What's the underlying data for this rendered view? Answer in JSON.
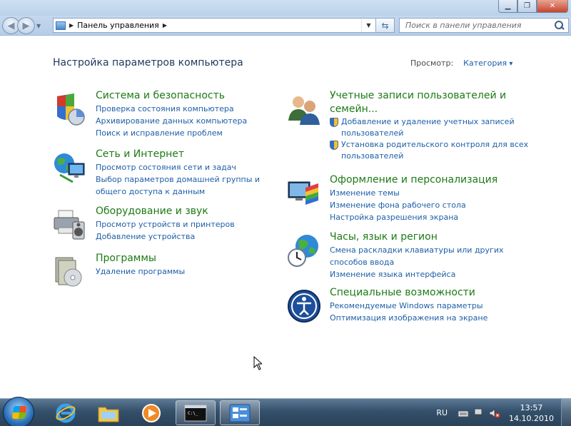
{
  "window": {
    "controls": {
      "minimize": "minimize-icon",
      "maximize": "maximize-icon",
      "close": "close-icon"
    }
  },
  "navbar": {
    "address": {
      "segments": [
        "Панель управления"
      ]
    },
    "search": {
      "placeholder": "Поиск в панели управления"
    }
  },
  "main": {
    "title": "Настройка параметров компьютера",
    "view": {
      "label": "Просмотр:",
      "value": "Категория"
    },
    "categories": [
      {
        "title": "Система и безопасность",
        "icon": "shield-icon",
        "links": [
          "Проверка состояния компьютера",
          "Архивирование данных компьютера",
          "Поиск и исправление проблем"
        ]
      },
      {
        "title": "Сеть и Интернет",
        "icon": "network-globe-icon",
        "links": [
          "Просмотр состояния сети и задач",
          "Выбор параметров домашней группы и",
          "общего доступа к данным"
        ]
      },
      {
        "title": "Оборудование и звук",
        "icon": "printer-speaker-icon",
        "links": [
          "Просмотр устройств и принтеров",
          "Добавление устройства"
        ]
      },
      {
        "title": "Программы",
        "icon": "programs-disc-icon",
        "links": [
          "Удаление программы"
        ]
      },
      {
        "title_lines": [
          "Учетные записи пользователей и",
          "семейн..."
        ],
        "icon": "users-icon",
        "links": [
          "Добавление и удаление учетных записей",
          "пользователей",
          "Установка родительского контроля для всех",
          "пользователей"
        ]
      },
      {
        "title": "Оформление и персонализация",
        "icon": "personalization-monitor-icon",
        "links": [
          "Изменение темы",
          "Изменение фона рабочего стола",
          "Настройка разрешения экрана"
        ]
      },
      {
        "title": "Часы, язык и регион",
        "icon": "clock-globe-icon",
        "links": [
          "Смена раскладки клавиатуры или других",
          "способов ввода",
          "Изменение языка интерфейса"
        ]
      },
      {
        "title": "Специальные возможности",
        "icon": "ease-of-access-icon",
        "links": [
          "Рекомендуемые Windows параметры",
          "Оптимизация изображения на экране"
        ]
      }
    ]
  },
  "taskbar": {
    "pinned": [
      "internet-explorer-icon",
      "explorer-folder-icon",
      "media-player-icon",
      "cmd-icon",
      "control-panel-icon"
    ],
    "tray": {
      "lang": "RU",
      "time": "13:57",
      "date": "14.10.2010"
    }
  }
}
